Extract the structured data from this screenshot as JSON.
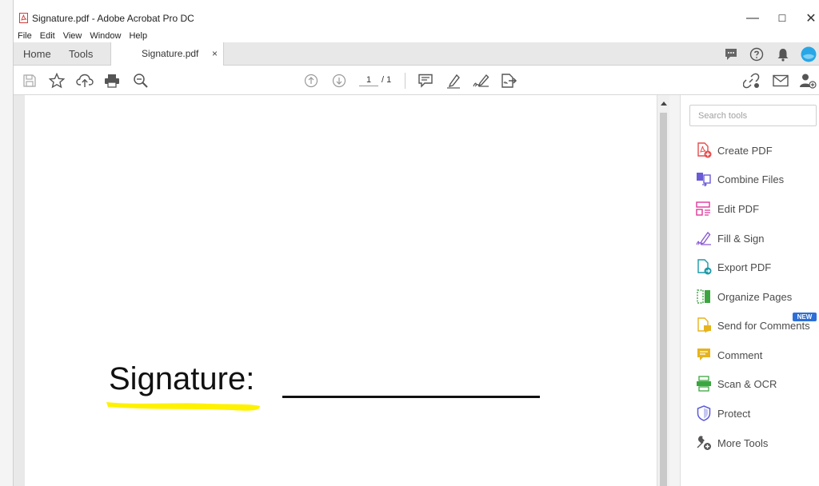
{
  "window": {
    "title": "Signature.pdf - Adobe Acrobat Pro DC",
    "minimize_symbol": "—",
    "maximize_symbol": "☐",
    "close_symbol": "✕"
  },
  "menu": [
    "File",
    "Edit",
    "View",
    "Window",
    "Help"
  ],
  "tabs": {
    "home": "Home",
    "tools": "Tools",
    "document": "Signature.pdf",
    "close_symbol": "×"
  },
  "toolbar": {
    "current_page": "1",
    "page_separator": "/ 1"
  },
  "document": {
    "signature_label": "Signature:"
  },
  "tools_pane": {
    "search_placeholder": "Search tools",
    "new_badge": "NEW",
    "items": [
      {
        "label": "Create PDF",
        "icon": "create-pdf-icon",
        "color": "#e64c4c"
      },
      {
        "label": "Combine Files",
        "icon": "combine-files-icon",
        "color": "#6a5bd6"
      },
      {
        "label": "Edit PDF",
        "icon": "edit-pdf-icon",
        "color": "#e0379b"
      },
      {
        "label": "Fill & Sign",
        "icon": "fill-sign-icon",
        "color": "#8a5ad6"
      },
      {
        "label": "Export PDF",
        "icon": "export-pdf-icon",
        "color": "#1b9aa8"
      },
      {
        "label": "Organize Pages",
        "icon": "organize-pages-icon",
        "color": "#3ba640"
      },
      {
        "label": "Send for Comments",
        "icon": "send-for-comments-icon",
        "color": "#e6b31e"
      },
      {
        "label": "Comment",
        "icon": "comment-icon",
        "color": "#e6b31e"
      },
      {
        "label": "Scan & OCR",
        "icon": "scan-ocr-icon",
        "color": "#3ba640"
      },
      {
        "label": "Protect",
        "icon": "protect-icon",
        "color": "#5b5bd6"
      },
      {
        "label": "More Tools",
        "icon": "more-tools-icon",
        "color": "#555555"
      }
    ]
  },
  "colors": {
    "highlight": "#fff200",
    "accent_blue": "#2d6fd6",
    "avatar": "#29a6e6"
  }
}
